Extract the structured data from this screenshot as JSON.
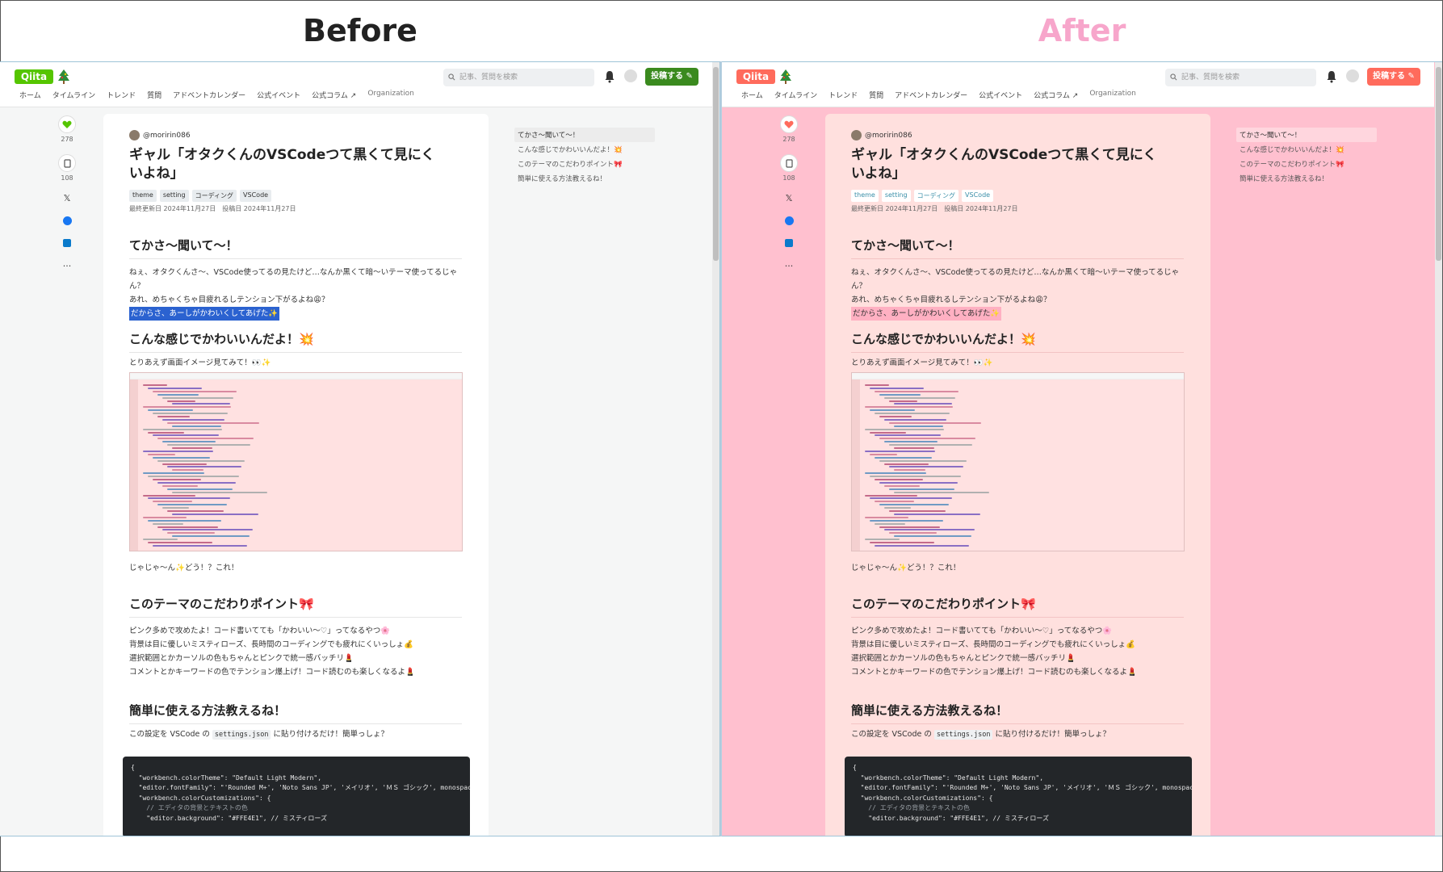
{
  "labels": {
    "before": "Before",
    "after": "After"
  },
  "header": {
    "logo": "Qiita",
    "search_placeholder": "記事、質問を検索",
    "post_button": "投稿する ✎",
    "nav": [
      "ホーム",
      "タイムライン",
      "トレンド",
      "質問",
      "アドベントカレンダー",
      "公式イベント",
      "公式コラム ↗",
      "Organization"
    ]
  },
  "rail": {
    "likes": "278",
    "stocks": "108"
  },
  "article": {
    "author": "@moririn086",
    "title": "ギャル「オタクくんのVSCodeつて黒くて見にくいよね」",
    "tags": [
      "theme",
      "setting",
      "コーディング",
      "VSCode"
    ],
    "dates": "最終更新日 2024年11月27日　投稿日 2024年11月27日",
    "sections": [
      {
        "heading": "てかさ～聞いて～！",
        "lines": [
          "ねぇ、オタクくんさ～、VSCode使ってるの見たけど…なんか黒くて暗～いテーマ使ってるじゃん？",
          "あれ、めちゃくちゃ目疲れるしテンション下がるよね😩？",
          "だからさ、あーしがかわいくしてあげた✨"
        ]
      },
      {
        "heading": "こんな感じでかわいいんだよ！💥",
        "lines": [
          "とりあえず画面イメージ見てみて！👀✨",
          "じゃじゃ～ん✨どう！？これ！"
        ]
      },
      {
        "heading": "このテーマのこだわりポイント🎀",
        "lines": [
          "ピンク多めで攻めたよ！コード書いてても「かわいい～♡」ってなるやつ🌸",
          "背景は目に優しいミスティローズ、長時間のコーディングでも疲れにくいっしょ💰",
          "選択範囲とかカーソルの色もちゃんとピンクで統一感バッチリ💄",
          "コメントとかキーワードの色でテンション爆上げ！コード読むのも楽しくなるよ💄"
        ]
      },
      {
        "heading": "簡単に使える方法教えるね！",
        "lines": [
          "この設定を VSCode の",
          "settings.json",
          "に貼り付けるだけ！簡単っしょ？"
        ]
      }
    ],
    "code": [
      "{",
      "  \"workbench.colorTheme\": \"Default Light Modern\",",
      "  \"editor.fontFamily\": \"'Rounded M+', 'Noto Sans JP', 'メイリオ', 'ＭＳ ゴシック', monospace\",",
      "  \"workbench.colorCustomizations\": {",
      "    // エディタの背景とテキストの色",
      "    \"editor.background\": \"#FFE4E1\", // ミスティローズ"
    ]
  },
  "toc": [
    "てかさ～聞いて～！",
    "こんな感じでかわいいんだよ！💥",
    "このテーマのこだわりポイント🎀",
    "簡単に使える方法教えるね！"
  ],
  "colors": {
    "qiita_green": "#55c500",
    "pink_bg": "#ffc0cf",
    "article_pink": "#ffe0de",
    "post_pink": "#ff6b5c"
  }
}
